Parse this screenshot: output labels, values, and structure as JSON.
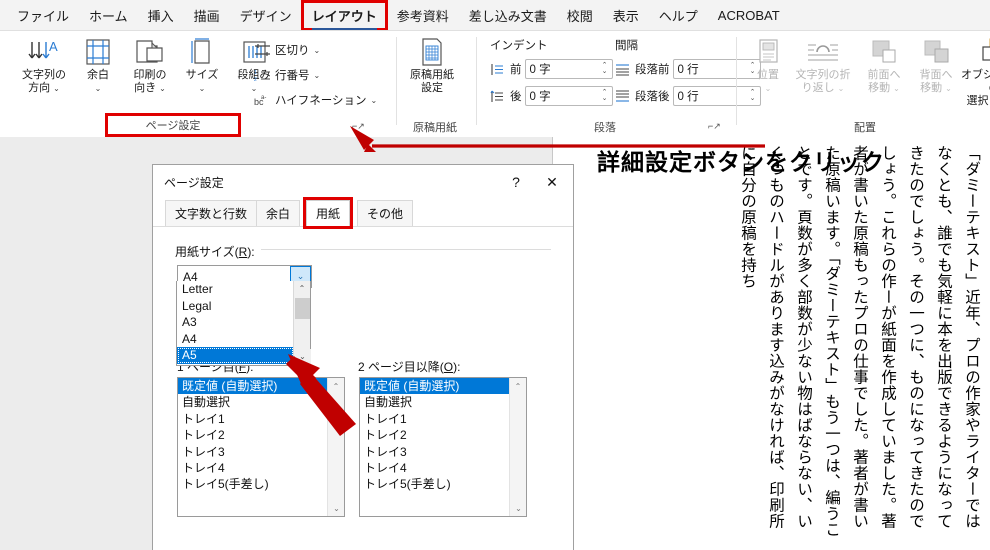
{
  "app": {
    "tabs": [
      {
        "label": "ファイル",
        "active": false
      },
      {
        "label": "ホーム",
        "active": false
      },
      {
        "label": "挿入",
        "active": false
      },
      {
        "label": "描画",
        "active": false
      },
      {
        "label": "デザイン",
        "active": false
      },
      {
        "label": "レイアウト",
        "active": true
      },
      {
        "label": "参考資料",
        "active": false
      },
      {
        "label": "差し込み文書",
        "active": false
      },
      {
        "label": "校閲",
        "active": false
      },
      {
        "label": "表示",
        "active": false
      },
      {
        "label": "ヘルプ",
        "active": false
      },
      {
        "label": "ACROBAT",
        "active": false
      }
    ]
  },
  "ribbon": {
    "page_setup": {
      "group_label": "ページ設定",
      "buttons": [
        {
          "label_line1": "文字列の",
          "label_line2": "方向",
          "icon": "text-direction-icon"
        },
        {
          "label_line1": "余白",
          "label_line2": "",
          "icon": "margins-icon"
        },
        {
          "label_line1": "印刷の",
          "label_line2": "向き",
          "icon": "orientation-icon"
        },
        {
          "label_line1": "サイズ",
          "label_line2": "",
          "icon": "size-icon"
        },
        {
          "label_line1": "段組み",
          "label_line2": "",
          "icon": "columns-icon"
        }
      ],
      "small_items": [
        {
          "label": "区切り",
          "icon": "breaks-icon"
        },
        {
          "label": "行番号",
          "icon": "line-numbers-icon"
        },
        {
          "label": "ハイフネーション",
          "icon": "hyphenation-icon"
        }
      ]
    },
    "manuscript": {
      "group_label": "原稿用紙",
      "button_line1": "原稿用紙",
      "button_line2": "設定",
      "icon": "manuscript-grid-icon"
    },
    "paragraph": {
      "group_label": "段落",
      "indent_header": "インデント",
      "spacing_header": "間隔",
      "fields": [
        {
          "label": "前",
          "value": "0 字",
          "icon": "indent-left-icon"
        },
        {
          "label": "後",
          "value": "0 字",
          "icon": "indent-right-icon"
        },
        {
          "label": "段落前",
          "value": "0 行",
          "icon": "space-before-icon"
        },
        {
          "label": "段落後",
          "value": "0 行",
          "icon": "space-after-icon"
        }
      ]
    },
    "arrange": {
      "group_label": "配置",
      "buttons": [
        {
          "label_line1": "位置",
          "label_line2": "",
          "icon": "position-icon",
          "disabled": true
        },
        {
          "label_line1": "文字列の折",
          "label_line2": "り返し",
          "icon": "wrap-text-icon",
          "disabled": true
        },
        {
          "label_line1": "前面へ",
          "label_line2": "移動",
          "icon": "bring-forward-icon",
          "disabled": true
        },
        {
          "label_line1": "背面へ",
          "label_line2": "移動",
          "icon": "send-backward-icon",
          "disabled": true
        },
        {
          "label_line1": "オブジェクトの",
          "label_line2": "選択と表示",
          "icon": "selection-pane-icon",
          "disabled": false
        }
      ]
    },
    "launcher_icon": "dialog-launcher-icon"
  },
  "annotation": {
    "text": "詳細設定ボタンをクリック",
    "color": "#e00000"
  },
  "dialog": {
    "title": "ページ設定",
    "help_icon": "?",
    "close_icon": "✕",
    "tabs": [
      {
        "label": "文字数と行数",
        "selected": false
      },
      {
        "label": "余白",
        "selected": false
      },
      {
        "label": "用紙",
        "selected": true
      },
      {
        "label": "その他",
        "selected": false
      }
    ],
    "paper_size": {
      "label_prefix": "用紙サイズ(",
      "label_key": "R",
      "label_suffix": "):",
      "value": "A4",
      "dropdown_open": true,
      "options": [
        "Letter",
        "Legal",
        "A3",
        "A4",
        "A5"
      ],
      "selected_option": "A5",
      "chevron": "⌄"
    },
    "tray_first": {
      "label_prefix": "1 ページ目(",
      "label_key": "F",
      "label_suffix": "):",
      "options": [
        "既定値 (自動選択)",
        "自動選択",
        "トレイ1",
        "トレイ2",
        "トレイ3",
        "トレイ4",
        "トレイ5(手差し)"
      ],
      "selected_option": "既定値 (自動選択)"
    },
    "tray_other": {
      "label_prefix": "2 ページ目以降(",
      "label_key": "O",
      "label_suffix": "):",
      "options": [
        "既定値 (自動選択)",
        "自動選択",
        "トレイ1",
        "トレイ2",
        "トレイ3",
        "トレイ4",
        "トレイ5(手差し)"
      ],
      "selected_option": "既定値 (自動選択)"
    }
  },
  "document": {
    "vertical_text": "「ダミーテキスト」近年、プロの作家やライターではなくとも、誰でも気軽に本を出版できるようになってきたのでしょう。その一つに、ものになってきたのでしょう。これらの作ーが紙面を作成していました。著者が書いた原稿もったプロの仕事でした。著者が書いた原稿います。「ダミーテキスト」もう一つは、編うことです。頁数が多く部数が少ない物はばならない、いくつものハードルがあります込みがなければ、印刷所に自分の原稿を持ち"
  },
  "colors": {
    "accent_blue": "#0078d7",
    "annotation_red": "#e00000",
    "ribbon_bg": "#f3f3f3",
    "doc_bg": "#ececec",
    "tab_underline": "#2b579a"
  }
}
